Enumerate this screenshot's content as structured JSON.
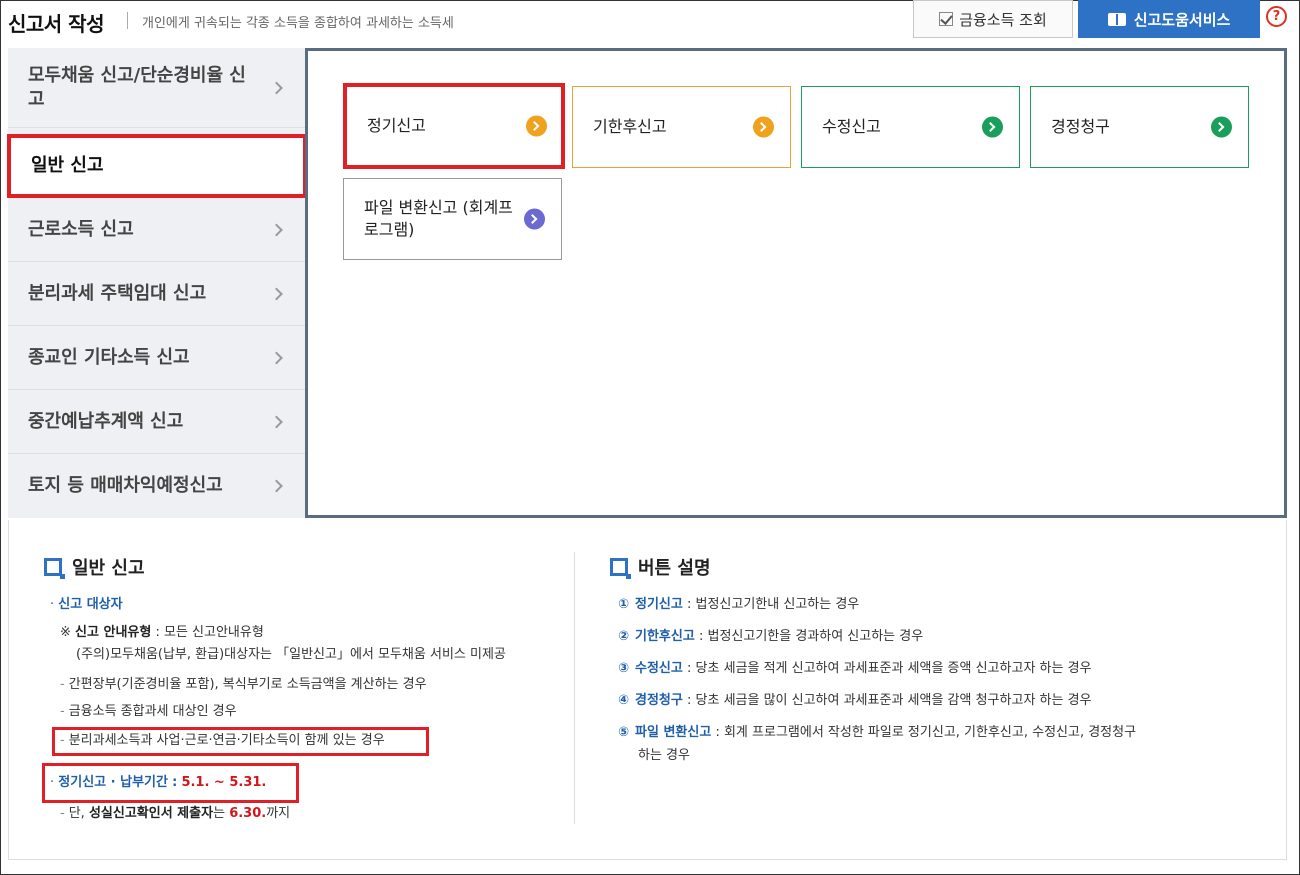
{
  "header": {
    "title": "신고서 작성",
    "subtitle": "개인에게 귀속되는 각종 소득을 종합하여 과세하는 소득세",
    "financial_income_button": "금융소득 조회",
    "help_service_button": "신고도움서비스",
    "help_icon": "?"
  },
  "sidebar": {
    "items": [
      {
        "label": "모두채움 신고/단순경비율 신고"
      },
      {
        "label": "일반 신고",
        "active": true
      },
      {
        "label": "근로소득 신고"
      },
      {
        "label": "분리과세 주택임대 신고"
      },
      {
        "label": "종교인 기타소득 신고"
      },
      {
        "label": "중간예납추계액 신고"
      },
      {
        "label": "토지 등 매매차익예정신고"
      }
    ]
  },
  "report_types": [
    {
      "label": "정기신고",
      "color": "#f0a21f",
      "selected": true
    },
    {
      "label": "기한후신고",
      "color": "#f0a21f"
    },
    {
      "label": "수정신고",
      "color": "#1a9e5b"
    },
    {
      "label": "경정청구",
      "color": "#1a9e5b"
    },
    {
      "label": "파일 변환신고 (회계프로그램)",
      "color": "#6a6ad0"
    }
  ],
  "general_section": {
    "title": "일반 신고",
    "target_heading": "신고 대상자",
    "note_prefix": "※",
    "note_label": "신고 안내유형",
    "note_text": ": 모든 신고안내유형",
    "note_sub": "(주의)모두채움(납부, 환급)대상자는 「일반신고」에서 모두채움 서비스 미제공",
    "items": [
      "간편장부(기준경비율 포함), 복식부기로 소득금액을 계산하는 경우",
      "금융소득 종합과세 대상인 경우",
      "분리과세소득과 사업·근로·연금·기타소득이 함께 있는 경우"
    ],
    "period_label": "정기신고 · 납부기간",
    "period_colon": ":",
    "period_value": "5.1. ~ 5.31.",
    "exception_prefix": "단,",
    "exception_bold": "성실신고확인서 제출자",
    "exception_mid": "는",
    "exception_date": "6.30.",
    "exception_suffix": "까지"
  },
  "button_section": {
    "title": "버튼 설명",
    "items": [
      {
        "num": "①",
        "name": "정기신고",
        "desc": ": 법정신고기한내 신고하는 경우"
      },
      {
        "num": "②",
        "name": "기한후신고",
        "desc": ": 법정신고기한을 경과하여 신고하는 경우"
      },
      {
        "num": "③",
        "name": "수정신고",
        "desc": ": 당초 세금을 적게 신고하여 과세표준과 세액을 증액 신고하고자 하는 경우"
      },
      {
        "num": "④",
        "name": "경정청구",
        "desc": ": 당초 세금을 많이 신고하여 과세표준과 세액을 감액 청구하고자 하는 경우"
      },
      {
        "num": "⑤",
        "name": "파일 변환신고",
        "desc": ": 회계 프로그램에서 작성한 파일로 정기신고, 기한후신고, 수정신고, 경정청구",
        "desc2": "하는 경우"
      }
    ]
  }
}
